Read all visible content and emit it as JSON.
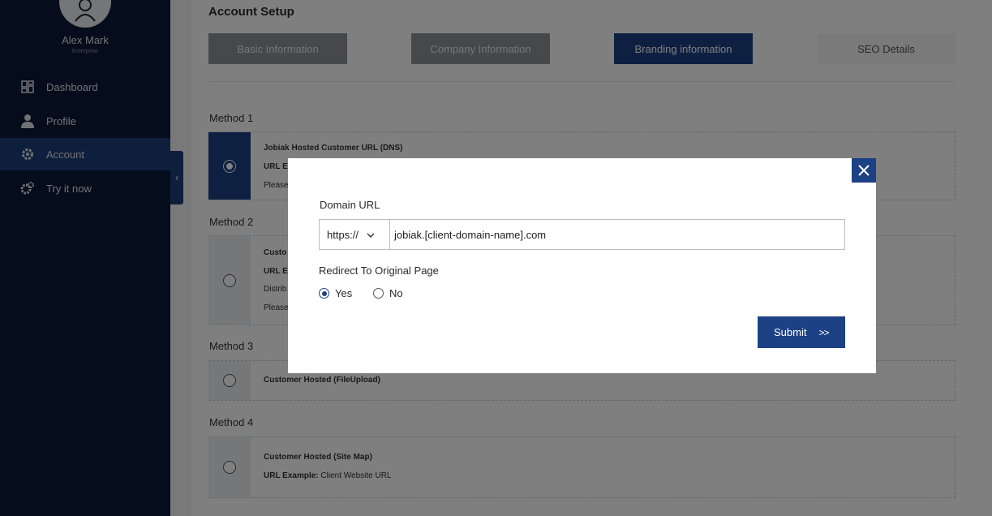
{
  "sidebar": {
    "user_name": "Alex Mark",
    "user_role": "Enterprise",
    "items": [
      {
        "label": "Dashboard",
        "icon": "dashboard-icon"
      },
      {
        "label": "Profile",
        "icon": "user-icon"
      },
      {
        "label": "Account",
        "icon": "gear-icon",
        "active": true
      },
      {
        "label": "Try it now",
        "icon": "gears-icon"
      }
    ],
    "collapse_glyph": "‹"
  },
  "main": {
    "title": "Account Setup",
    "tabs": [
      {
        "label": "Basic Information"
      },
      {
        "label": "Company Information"
      },
      {
        "label": "Branding information",
        "active": true
      },
      {
        "label": "SEO Details"
      }
    ],
    "methods": [
      {
        "label": "Method 1",
        "title": "Jobiak Hosted Customer URL (DNS)",
        "line2": "URL E",
        "line3": "Please",
        "selected": true
      },
      {
        "label": "Method 2",
        "title": "Custo",
        "line2": "URL E",
        "line3": "Distrib",
        "line4": "Please"
      },
      {
        "label": "Method 3",
        "title": "Customer Hosted (FileUpload)"
      },
      {
        "label": "Method 4",
        "title": "Customer Hosted (Site Map)",
        "line2_key": "URL Example:",
        "line2_val": " Client Website URL"
      }
    ]
  },
  "modal": {
    "domain_label": "Domain URL",
    "protocol_value": "https://",
    "url_value": "jobiak.[client-domain-name].com",
    "redirect_label": "Redirect To Original Page",
    "options": {
      "yes": "Yes",
      "no": "No"
    },
    "selected_option": "yes",
    "submit_label": "Submit",
    "submit_arrow": ">>"
  },
  "colors": {
    "sidebar_bg": "#0b1937",
    "accent": "#1d4185",
    "overlay": "rgba(0,0,0,0.5)"
  }
}
